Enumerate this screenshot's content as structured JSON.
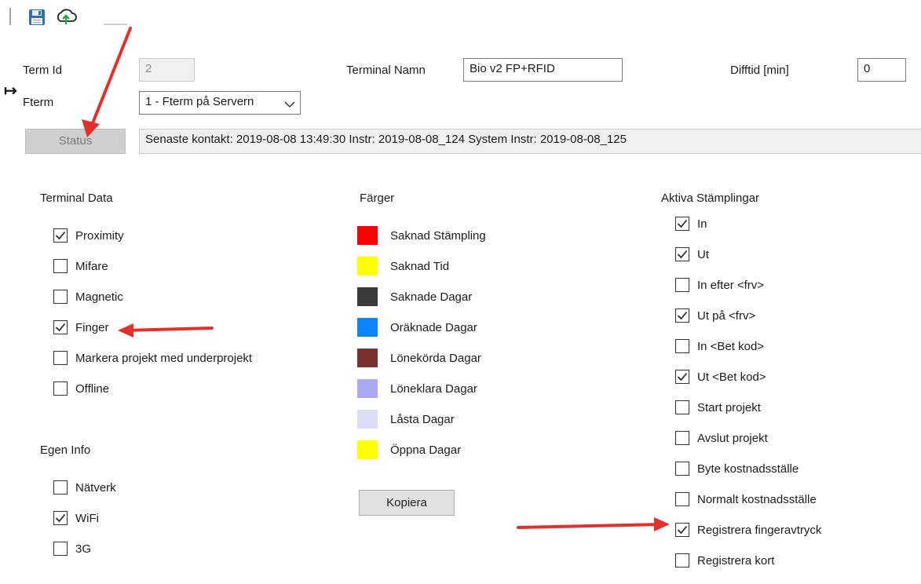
{
  "toolbar": {
    "save_icon": "save-icon",
    "upload_icon": "cloud-upload-icon"
  },
  "terminal": {
    "term_id_label": "Term Id",
    "term_id_value": "2",
    "name_label": "Terminal Namn",
    "name_value": "Bio v2 FP+RFID",
    "difftid_label": "Difftid [min]",
    "difftid_value": "0",
    "fterm_label": "Fterm",
    "fterm_selected": "1 - Fterm på Servern",
    "status_button": "Status",
    "status_text": "Senaste kontakt: 2019-08-08 13:49:30 Instr: 2019-08-08_124 System Instr: 2019-08-08_125"
  },
  "terminal_data": {
    "title": "Terminal Data",
    "items": [
      {
        "label": "Proximity",
        "checked": true
      },
      {
        "label": "Mifare",
        "checked": false
      },
      {
        "label": "Magnetic",
        "checked": false
      },
      {
        "label": "Finger",
        "checked": true
      },
      {
        "label": "Markera projekt med underprojekt",
        "checked": false
      },
      {
        "label": "Offline",
        "checked": false
      }
    ]
  },
  "egen_info": {
    "title": "Egen Info",
    "items": [
      {
        "label": "Nätverk",
        "checked": false
      },
      {
        "label": "WiFi",
        "checked": true
      },
      {
        "label": "3G",
        "checked": false
      }
    ]
  },
  "colors": {
    "title": "Färger",
    "items": [
      {
        "label": "Saknad Stämpling",
        "color": "#ff0000"
      },
      {
        "label": "Saknad Tid",
        "color": "#ffff00"
      },
      {
        "label": "Saknade Dagar",
        "color": "#3a3a3a"
      },
      {
        "label": "Oräknade Dagar",
        "color": "#0a84ff"
      },
      {
        "label": "Lönekörda Dagar",
        "color": "#7b3030"
      },
      {
        "label": "Löneklara Dagar",
        "color": "#a9a9f5"
      },
      {
        "label": "Låsta Dagar",
        "color": "#dcdcf7"
      },
      {
        "label": "Öppna Dagar",
        "color": "#ffff00"
      }
    ],
    "copy_button": "Kopiera"
  },
  "active": {
    "title": "Aktiva Stämplingar",
    "items": [
      {
        "label": "In",
        "checked": true
      },
      {
        "label": "Ut",
        "checked": true
      },
      {
        "label": "In efter <frv>",
        "checked": false
      },
      {
        "label": "Ut på <frv>",
        "checked": true
      },
      {
        "label": "In <Bet kod>",
        "checked": false
      },
      {
        "label": "Ut <Bet kod>",
        "checked": true
      },
      {
        "label": "Start projekt",
        "checked": false
      },
      {
        "label": "Avslut projekt",
        "checked": false
      },
      {
        "label": "Byte kostnadsställe",
        "checked": false
      },
      {
        "label": "Normalt kostnadsställe",
        "checked": false
      },
      {
        "label": "Registrera fingeravtryck",
        "checked": true
      },
      {
        "label": "Registrera kort",
        "checked": false
      }
    ]
  },
  "annotation_color": "#e2312b"
}
